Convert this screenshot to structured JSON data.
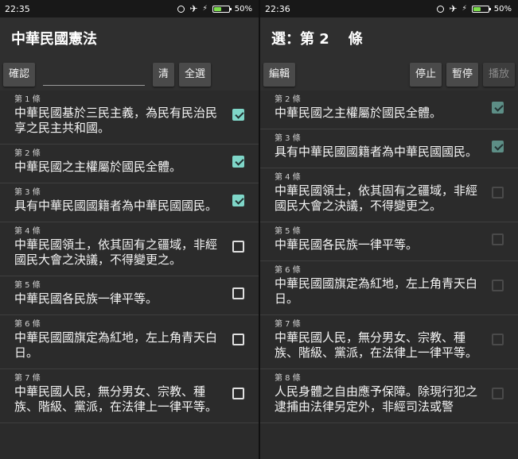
{
  "left": {
    "status": {
      "time": "22:35",
      "battery": "50%",
      "battery_level": 0.5
    },
    "title": "中華民國憲法",
    "toolbar": {
      "confirm": "確認",
      "input_value": "",
      "clear": "清",
      "select_all": "全選"
    },
    "items": [
      {
        "no": "第 1 條",
        "text": "中華民國基於三民主義，為民有民治民享之民主共和國。",
        "checked": true
      },
      {
        "no": "第 2 條",
        "text": "中華民國之主權屬於國民全體。",
        "checked": true
      },
      {
        "no": "第 3 條",
        "text": "具有中華民國國籍者為中華民國國民。",
        "checked": true
      },
      {
        "no": "第 4 條",
        "text": "中華民國領土，依其固有之疆域，非經國民大會之決議，不得變更之。",
        "checked": false
      },
      {
        "no": "第 5 條",
        "text": "中華民國各民族一律平等。",
        "checked": false
      },
      {
        "no": "第 6 條",
        "text": "中華民國國旗定為紅地，左上角青天白日。",
        "checked": false
      },
      {
        "no": "第 7 條",
        "text": "中華民國人民，無分男女、宗教、種族、階級、黨派，在法律上一律平等。",
        "checked": false
      }
    ]
  },
  "right": {
    "status": {
      "time": "22:36",
      "battery": "50%",
      "battery_level": 0.5
    },
    "title_prefix": "選：第 2",
    "title_suffix": "條",
    "toolbar": {
      "edit": "編輯",
      "stop": "停止",
      "pause": "暫停",
      "play": "播放"
    },
    "items": [
      {
        "no": "第 2 條",
        "text": "中華民國之主權屬於國民全體。",
        "checked": true
      },
      {
        "no": "第 3 條",
        "text": "具有中華民國國籍者為中華民國國民。",
        "checked": true
      },
      {
        "no": "第 4 條",
        "text": "中華民國領土，依其固有之疆域，非經國民大會之決議，不得變更之。",
        "checked": false
      },
      {
        "no": "第 5 條",
        "text": "中華民國各民族一律平等。",
        "checked": false
      },
      {
        "no": "第 6 條",
        "text": "中華民國國旗定為紅地，左上角青天白日。",
        "checked": false
      },
      {
        "no": "第 7 條",
        "text": "中華民國人民，無分男女、宗教、種族、階級、黨派，在法律上一律平等。",
        "checked": false
      },
      {
        "no": "第 8 條",
        "text": "人民身體之自由應予保障。除現行犯之逮捕由法律另定外，非經司法或警",
        "checked": false
      }
    ]
  }
}
